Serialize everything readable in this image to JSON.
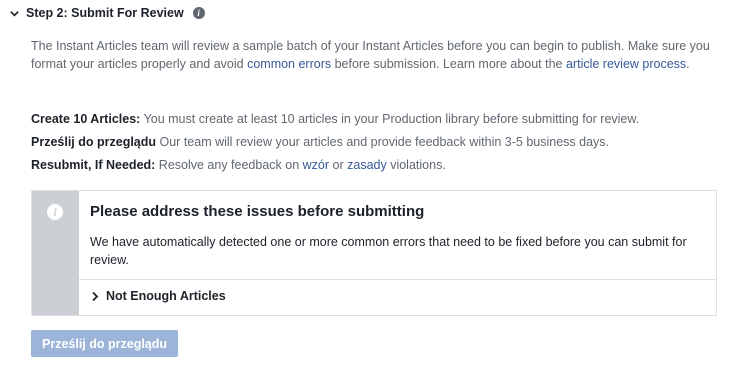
{
  "step": {
    "title": "Step 2: Submit For Review",
    "info_icon": "info-icon"
  },
  "description": {
    "text_1": "The Instant Articles team will review a sample batch of your Instant Articles before you can begin to publish. Make sure you format your articles properly and avoid ",
    "link_1": "common errors",
    "text_2": " before submission. Learn more about the ",
    "link_2": "article review process",
    "text_3": "."
  },
  "requirements": [
    {
      "label": "Create 10 Articles:",
      "text": " You must create at least 10 articles in your Production library before submitting for review."
    },
    {
      "label": "Prześlij do przeglądu",
      "text": " Our team will review your articles and provide feedback within 3-5 business days."
    },
    {
      "label": "Resubmit, If Needed:",
      "text_1": " Resolve any feedback on ",
      "link_1": "wzór",
      "text_2": " or ",
      "link_2": "zasady",
      "text_3": " violations."
    }
  ],
  "panel": {
    "icon": "info-icon",
    "title": "Please address these issues before submitting",
    "body": "We have automatically detected one or more common errors that need to be fixed before you can submit for review.",
    "issue": "Not Enough Articles",
    "issue_icon": "chevron-right-icon"
  },
  "submit_button": {
    "label": "Prześlij do przeglądu",
    "disabled": true
  },
  "colors": {
    "link": "#365899",
    "button_disabled": "#9cb4d8",
    "panel_side": "#cccfd4",
    "muted_text": "#606770"
  }
}
